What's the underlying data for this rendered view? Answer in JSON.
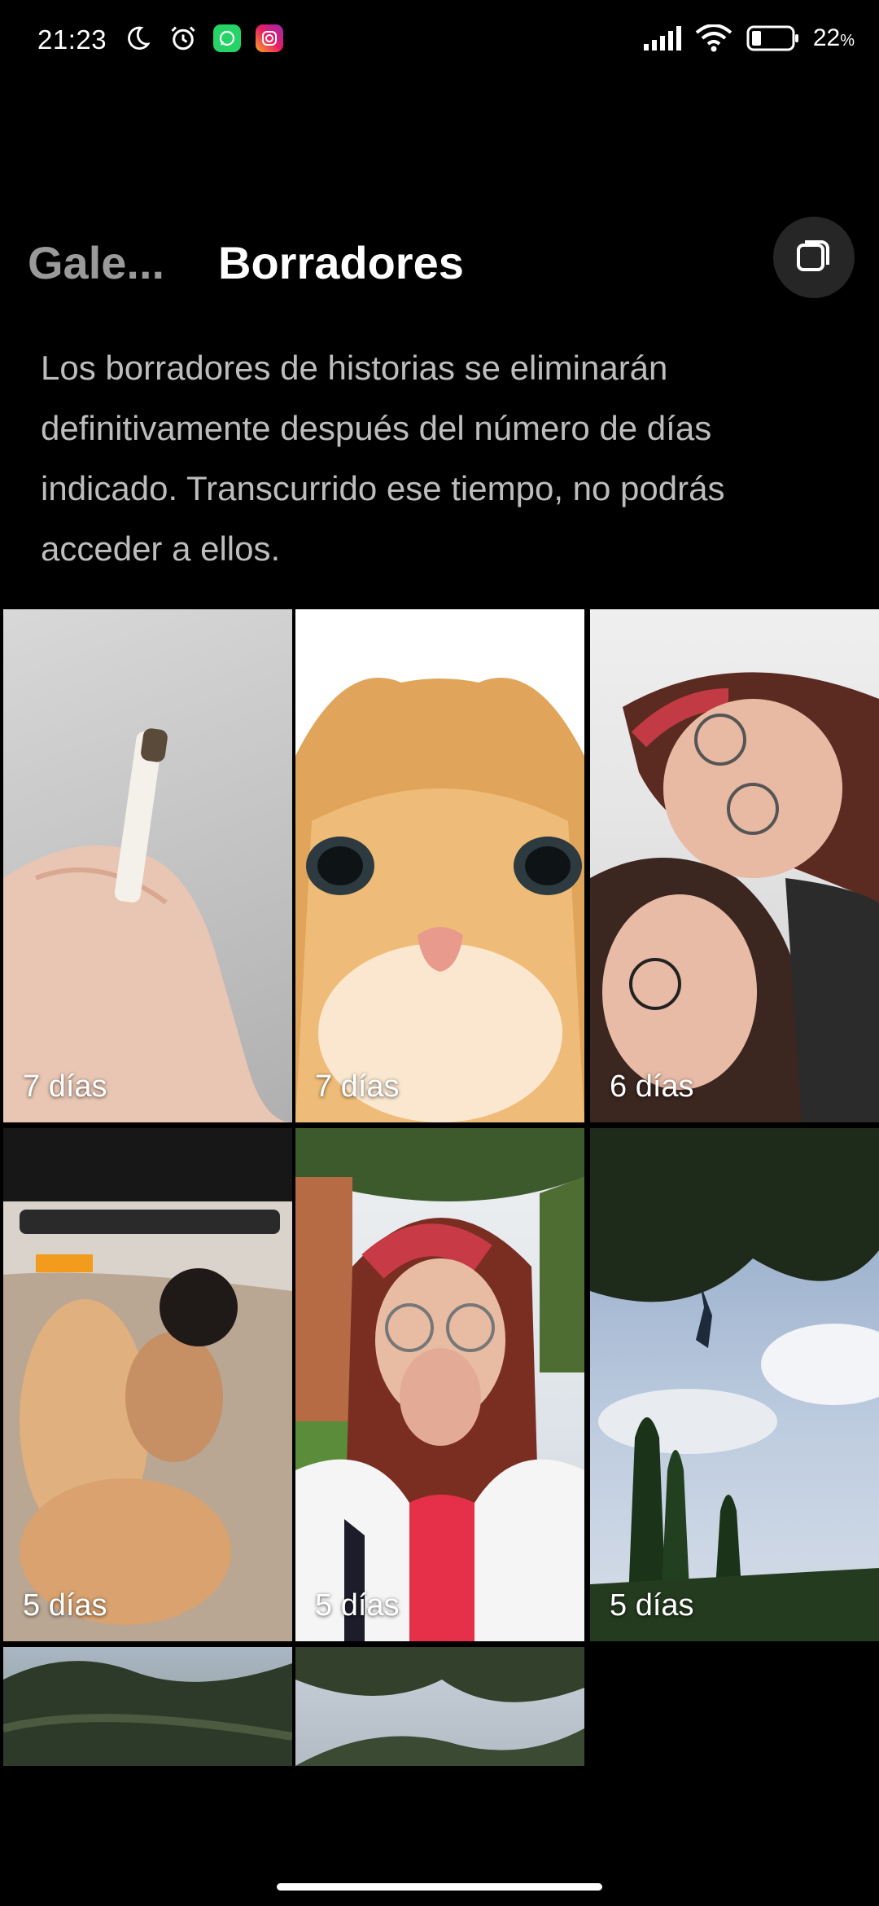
{
  "status_bar": {
    "time": "21:23",
    "battery": "22",
    "battery_unit": "%"
  },
  "header": {
    "tab_gallery": "Gale...",
    "tab_drafts": "Borradores",
    "select_multiple_icon": "stack-select-icon"
  },
  "description": "Los borradores de historias se eliminarán definitivamente después del número de días indicado. Transcurrido ese tiempo, no podrás acceder a ellos.",
  "drafts": [
    {
      "label": "7 días",
      "thumb": "hand-holding-cigarette"
    },
    {
      "label": "7 días",
      "thumb": "orange-kitten-face"
    },
    {
      "label": "6 días",
      "thumb": "two-people-selfie"
    },
    {
      "label": "5 días",
      "thumb": "browser-screenshot-couple"
    },
    {
      "label": "5 días",
      "thumb": "girl-covering-mouth"
    },
    {
      "label": "5 días",
      "thumb": "trees-and-sky"
    },
    {
      "label": "",
      "thumb": "tree-branches"
    },
    {
      "label": "",
      "thumb": "tree-branches"
    }
  ],
  "colors": {
    "background": "#000000",
    "muted_tab": "#9a9a9a",
    "description_text": "#bdbdbd",
    "button_bg": "#262626"
  }
}
